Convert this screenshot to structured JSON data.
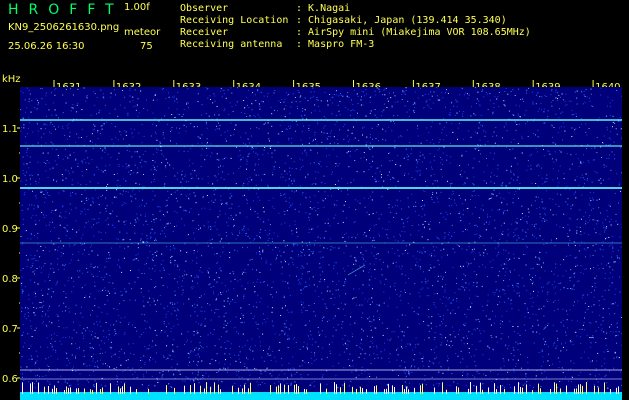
{
  "header": {
    "app_title": "HROFFT",
    "version": "1.00f",
    "filename": "KN9_2506261630.png",
    "meteor_label": "meteor",
    "datetime": "25.06.26 16:30",
    "meteor_count": "75"
  },
  "info": [
    {
      "key": "Observer",
      "value": ": K.Nagai"
    },
    {
      "key": "Receiving Location",
      "value": ": Chigasaki, Japan (139.414 35.340)"
    },
    {
      "key": "Receiver",
      "value": ": AirSpy mini (Miakejima VOR 108.65MHz)"
    },
    {
      "key": "Receiving antenna",
      "value": ": Maspro FM-3"
    }
  ],
  "y_axis": {
    "unit": "kHz",
    "ticks": [
      "1.1",
      "1.0",
      "0.9",
      "0.8",
      "0.7",
      "0.6"
    ]
  },
  "time_labels": [
    "1631",
    "1632",
    "1633",
    "1634",
    "1635",
    "1636",
    "1637",
    "1638",
    "1639",
    "1640"
  ],
  "colors": {
    "background": "#000000",
    "plot_background": "#00007a",
    "label": "#ffff55",
    "title": "#00ff66",
    "signal_line": "#66ffee",
    "baseline": "#00e0ff"
  }
}
